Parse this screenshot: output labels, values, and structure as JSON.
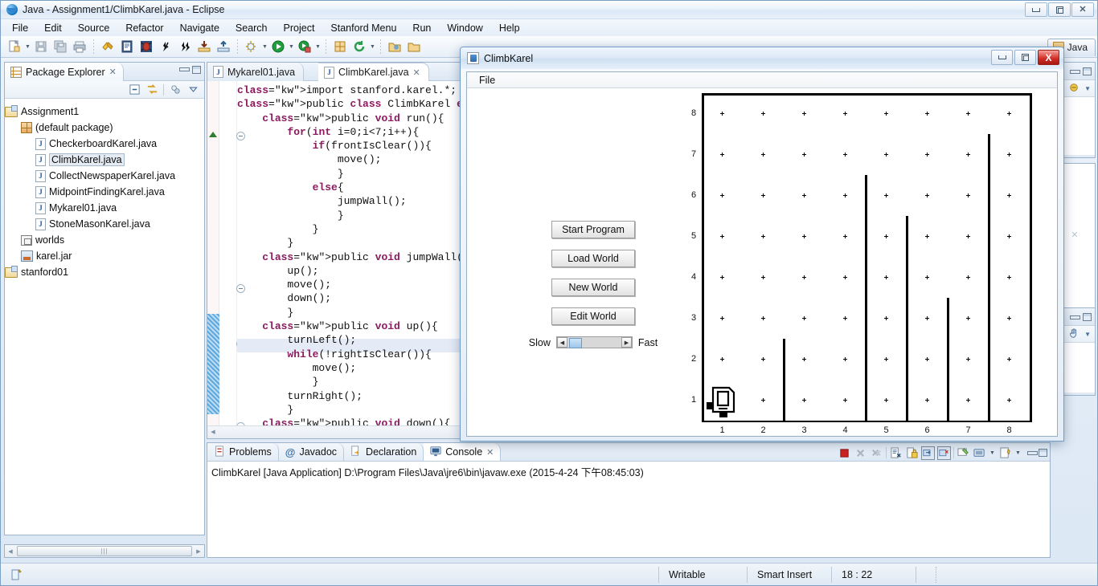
{
  "window": {
    "title": "Java - Assignment1/ClimbKarel.java - Eclipse",
    "min_label": "Minimize",
    "restore_label": "Restore",
    "close_label": "Close"
  },
  "menubar": {
    "items": [
      "File",
      "Edit",
      "Source",
      "Refactor",
      "Navigate",
      "Search",
      "Project",
      "Stanford Menu",
      "Run",
      "Window",
      "Help"
    ]
  },
  "perspective": {
    "label": "Java"
  },
  "package_explorer": {
    "tab_label": "Package Explorer",
    "close_label": "x",
    "tree": [
      {
        "label": "Assignment1",
        "icon": "project-folder-icon",
        "indent": 0,
        "selected": false
      },
      {
        "label": "(default package)",
        "icon": "package-icon",
        "indent": 1,
        "selected": false
      },
      {
        "label": "CheckerboardKarel.java",
        "icon": "java-file-icon",
        "indent": 2,
        "selected": false
      },
      {
        "label": "ClimbKarel.java",
        "icon": "java-file-icon",
        "indent": 2,
        "selected": true
      },
      {
        "label": "CollectNewspaperKarel.java",
        "icon": "java-file-icon",
        "indent": 2,
        "selected": false
      },
      {
        "label": "MidpointFindingKarel.java",
        "icon": "java-file-icon",
        "indent": 2,
        "selected": false
      },
      {
        "label": "Mykarel01.java",
        "icon": "java-file-icon",
        "indent": 2,
        "selected": false
      },
      {
        "label": "StoneMasonKarel.java",
        "icon": "java-file-icon",
        "indent": 2,
        "selected": false
      },
      {
        "label": "worlds",
        "icon": "worlds-folder-icon",
        "indent": 1,
        "selected": false
      },
      {
        "label": "karel.jar",
        "icon": "jar-icon",
        "indent": 1,
        "selected": false
      },
      {
        "label": "stanford01",
        "icon": "project-folder-icon",
        "indent": 0,
        "selected": false
      }
    ]
  },
  "editor": {
    "tabs": [
      {
        "label": "Mykarel01.java",
        "active": false,
        "closeable": false
      },
      {
        "label": "ClimbKarel.java",
        "active": true,
        "closeable": true
      }
    ],
    "code_lines": [
      "import stanford.karel.*;",
      "public class ClimbKarel extends Kar",
      "    public void run(){",
      "        for(int i=0;i<7;i++){",
      "            if(frontIsClear()){",
      "                move();",
      "                }",
      "            else{",
      "                jumpWall();",
      "                }",
      "            }",
      "        }",
      "    public void jumpWall(){",
      "        up();",
      "        move();",
      "        down();",
      "        }",
      "    public void up(){",
      "        turnLeft();",
      "        while(!rightIsClear()){",
      "            move();",
      "            }",
      "        turnRight();",
      "        }",
      "    public void down(){"
    ]
  },
  "console": {
    "tabs": [
      {
        "label": "Problems",
        "icon": "problems-icon",
        "active": false
      },
      {
        "label": "Javadoc",
        "icon": "javadoc-icon",
        "active": false
      },
      {
        "label": "Declaration",
        "icon": "declaration-icon",
        "active": false
      },
      {
        "label": "Console",
        "icon": "console-icon",
        "active": true
      }
    ],
    "close_label": "x",
    "launch_line": "ClimbKarel [Java Application] D:\\Program Files\\Java\\jre6\\bin\\javaw.exe (2015-4-24 下午08:45:03)",
    "toolbar_icons": [
      "terminate-icon",
      "remove-launch-icon",
      "remove-all-terminated-icon",
      "clear-console-icon",
      "scroll-lock-icon",
      "pin-console-icon",
      "display-selected-console-icon",
      "open-console-icon",
      "new-console-view-icon",
      "console-menu-icon"
    ]
  },
  "statusbar": {
    "writable": "Writable",
    "insert_mode": "Smart Insert",
    "position": "18 : 22"
  },
  "karel_dialog": {
    "title": "ClimbKarel",
    "menu": [
      "File"
    ],
    "buttons": [
      "Start Program",
      "Load World",
      "New World",
      "Edit World"
    ],
    "speed_slow_label": "Slow",
    "speed_fast_label": "Fast",
    "min_label": "Minimize",
    "restore_label": "Restore",
    "close_label": "X"
  },
  "karel_world": {
    "columns": 8,
    "rows": 8,
    "col_labels": [
      "1",
      "2",
      "3",
      "4",
      "5",
      "6",
      "7",
      "8"
    ],
    "row_labels": [
      "1",
      "2",
      "3",
      "4",
      "5",
      "6",
      "7",
      "8"
    ],
    "walls": [
      {
        "after_column": 2,
        "height_rows": 2
      },
      {
        "after_column": 4,
        "height_rows": 6
      },
      {
        "after_column": 5,
        "height_rows": 5
      },
      {
        "after_column": 6,
        "height_rows": 3
      },
      {
        "after_column": 7,
        "height_rows": 7
      }
    ],
    "karel": {
      "column": 1,
      "row": 1,
      "direction": "east"
    },
    "beeper_marker_color": "#000000",
    "border_color": "#000000"
  },
  "toolbar": {
    "groups": [
      [
        "new-icon",
        "new-dropdown-icon",
        "save-icon",
        "save-all-icon",
        "print-icon"
      ],
      [
        "build-icon",
        "open-type-icon",
        "debug-icon",
        "run-last-icon",
        "run-fast-icon",
        "import-icon",
        "export-icon"
      ],
      [
        "new-class-icon",
        "new-class-dropdown-icon",
        "run-icon",
        "run-dropdown-icon",
        "coverage-icon",
        "coverage-dropdown-icon"
      ],
      [
        "search-icon",
        "refresh-icon",
        "refresh-dropdown-icon"
      ],
      [
        "open-folder-icon",
        "open-folder2-icon"
      ]
    ]
  }
}
